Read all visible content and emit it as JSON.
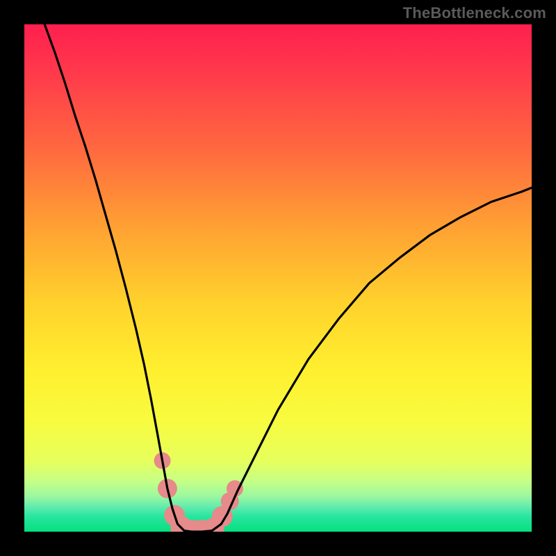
{
  "watermark": "TheBottleneck.com",
  "chart_data": {
    "type": "line",
    "title": "",
    "xlabel": "",
    "ylabel": "",
    "xlim": [
      0,
      1
    ],
    "ylim": [
      0,
      1
    ],
    "axes_visible": false,
    "grid": false,
    "series": [
      {
        "name": "bottleneck-curve",
        "stroke": "#000000",
        "x": [
          0.04,
          0.06,
          0.08,
          0.1,
          0.12,
          0.14,
          0.16,
          0.18,
          0.2,
          0.22,
          0.236,
          0.25,
          0.262,
          0.272,
          0.282,
          0.292,
          0.302,
          0.315,
          0.33,
          0.35,
          0.37,
          0.388,
          0.4,
          0.42,
          0.45,
          0.5,
          0.56,
          0.62,
          0.68,
          0.74,
          0.8,
          0.86,
          0.92,
          0.98,
          1.0
        ],
        "y": [
          1.0,
          0.945,
          0.885,
          0.82,
          0.76,
          0.695,
          0.625,
          0.555,
          0.48,
          0.4,
          0.33,
          0.26,
          0.195,
          0.14,
          0.085,
          0.045,
          0.015,
          0.002,
          0.0,
          0.0,
          0.002,
          0.015,
          0.035,
          0.08,
          0.14,
          0.24,
          0.34,
          0.42,
          0.49,
          0.54,
          0.585,
          0.62,
          0.65,
          0.67,
          0.678
        ]
      }
    ],
    "highlight_band": {
      "name": "optimal-zone-markers",
      "fill": "#e68a8a",
      "points": [
        {
          "x": 0.272,
          "y": 0.14
        },
        {
          "x": 0.282,
          "y": 0.085
        },
        {
          "x": 0.296,
          "y": 0.032
        },
        {
          "x": 0.31,
          "y": 0.008
        },
        {
          "x": 0.33,
          "y": 0.0
        },
        {
          "x": 0.35,
          "y": 0.0
        },
        {
          "x": 0.372,
          "y": 0.005
        },
        {
          "x": 0.39,
          "y": 0.03
        },
        {
          "x": 0.405,
          "y": 0.06
        },
        {
          "x": 0.415,
          "y": 0.085
        }
      ],
      "radii": [
        12,
        14,
        15,
        16,
        17,
        17,
        16,
        15,
        13,
        12
      ],
      "base_bar": {
        "x_start": 0.3,
        "x_end": 0.385,
        "y": 0.0,
        "height": 0.022
      }
    },
    "gradient_stops": [
      {
        "offset": 0.0,
        "color": "#ff1f4e"
      },
      {
        "offset": 0.1,
        "color": "#ff3b4b"
      },
      {
        "offset": 0.25,
        "color": "#ff6a3f"
      },
      {
        "offset": 0.4,
        "color": "#ffa133"
      },
      {
        "offset": 0.55,
        "color": "#ffd22c"
      },
      {
        "offset": 0.68,
        "color": "#ffef2f"
      },
      {
        "offset": 0.78,
        "color": "#f8fb3e"
      },
      {
        "offset": 0.86,
        "color": "#e7ff5c"
      },
      {
        "offset": 0.9,
        "color": "#c6ff85"
      },
      {
        "offset": 0.93,
        "color": "#9cf8a0"
      },
      {
        "offset": 0.95,
        "color": "#65ecae"
      },
      {
        "offset": 0.97,
        "color": "#29e5a0"
      },
      {
        "offset": 1.0,
        "color": "#05e07e"
      }
    ]
  }
}
